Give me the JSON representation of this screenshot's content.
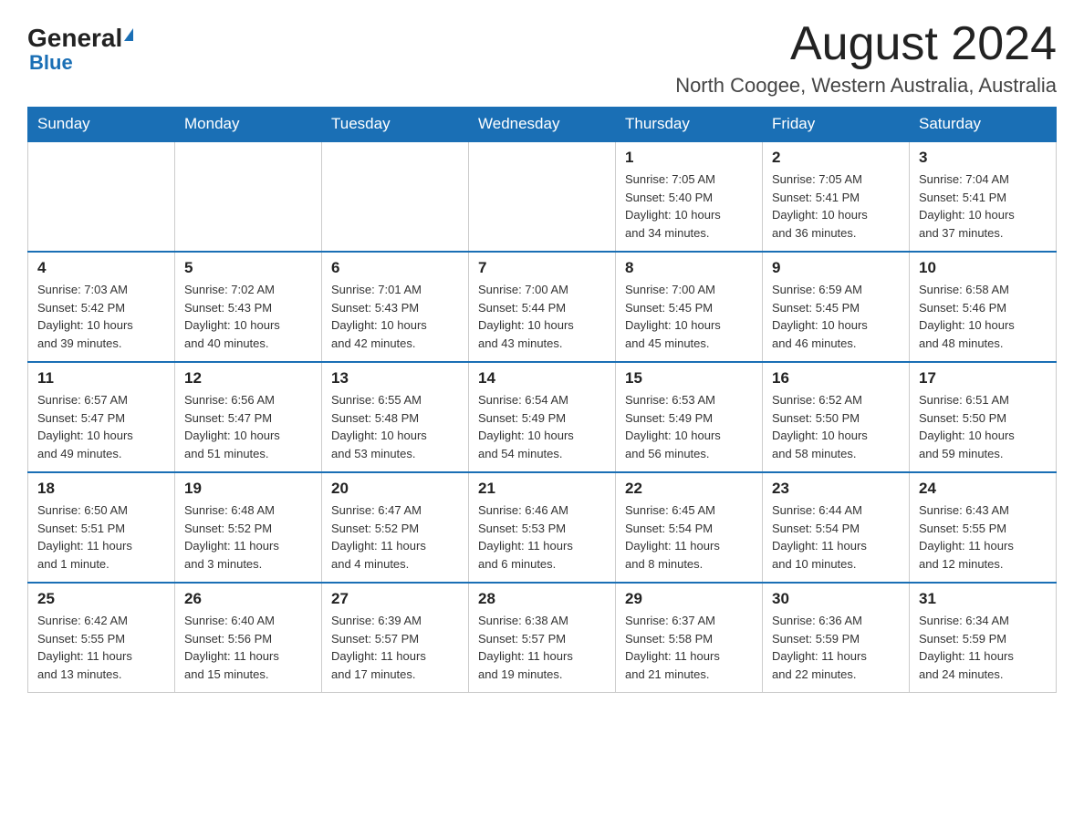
{
  "header": {
    "logo_general": "General",
    "logo_blue": "Blue",
    "month_title": "August 2024",
    "location": "North Coogee, Western Australia, Australia"
  },
  "days_of_week": [
    "Sunday",
    "Monday",
    "Tuesday",
    "Wednesday",
    "Thursday",
    "Friday",
    "Saturday"
  ],
  "weeks": [
    [
      {
        "day": "",
        "info": ""
      },
      {
        "day": "",
        "info": ""
      },
      {
        "day": "",
        "info": ""
      },
      {
        "day": "",
        "info": ""
      },
      {
        "day": "1",
        "info": "Sunrise: 7:05 AM\nSunset: 5:40 PM\nDaylight: 10 hours\nand 34 minutes."
      },
      {
        "day": "2",
        "info": "Sunrise: 7:05 AM\nSunset: 5:41 PM\nDaylight: 10 hours\nand 36 minutes."
      },
      {
        "day": "3",
        "info": "Sunrise: 7:04 AM\nSunset: 5:41 PM\nDaylight: 10 hours\nand 37 minutes."
      }
    ],
    [
      {
        "day": "4",
        "info": "Sunrise: 7:03 AM\nSunset: 5:42 PM\nDaylight: 10 hours\nand 39 minutes."
      },
      {
        "day": "5",
        "info": "Sunrise: 7:02 AM\nSunset: 5:43 PM\nDaylight: 10 hours\nand 40 minutes."
      },
      {
        "day": "6",
        "info": "Sunrise: 7:01 AM\nSunset: 5:43 PM\nDaylight: 10 hours\nand 42 minutes."
      },
      {
        "day": "7",
        "info": "Sunrise: 7:00 AM\nSunset: 5:44 PM\nDaylight: 10 hours\nand 43 minutes."
      },
      {
        "day": "8",
        "info": "Sunrise: 7:00 AM\nSunset: 5:45 PM\nDaylight: 10 hours\nand 45 minutes."
      },
      {
        "day": "9",
        "info": "Sunrise: 6:59 AM\nSunset: 5:45 PM\nDaylight: 10 hours\nand 46 minutes."
      },
      {
        "day": "10",
        "info": "Sunrise: 6:58 AM\nSunset: 5:46 PM\nDaylight: 10 hours\nand 48 minutes."
      }
    ],
    [
      {
        "day": "11",
        "info": "Sunrise: 6:57 AM\nSunset: 5:47 PM\nDaylight: 10 hours\nand 49 minutes."
      },
      {
        "day": "12",
        "info": "Sunrise: 6:56 AM\nSunset: 5:47 PM\nDaylight: 10 hours\nand 51 minutes."
      },
      {
        "day": "13",
        "info": "Sunrise: 6:55 AM\nSunset: 5:48 PM\nDaylight: 10 hours\nand 53 minutes."
      },
      {
        "day": "14",
        "info": "Sunrise: 6:54 AM\nSunset: 5:49 PM\nDaylight: 10 hours\nand 54 minutes."
      },
      {
        "day": "15",
        "info": "Sunrise: 6:53 AM\nSunset: 5:49 PM\nDaylight: 10 hours\nand 56 minutes."
      },
      {
        "day": "16",
        "info": "Sunrise: 6:52 AM\nSunset: 5:50 PM\nDaylight: 10 hours\nand 58 minutes."
      },
      {
        "day": "17",
        "info": "Sunrise: 6:51 AM\nSunset: 5:50 PM\nDaylight: 10 hours\nand 59 minutes."
      }
    ],
    [
      {
        "day": "18",
        "info": "Sunrise: 6:50 AM\nSunset: 5:51 PM\nDaylight: 11 hours\nand 1 minute."
      },
      {
        "day": "19",
        "info": "Sunrise: 6:48 AM\nSunset: 5:52 PM\nDaylight: 11 hours\nand 3 minutes."
      },
      {
        "day": "20",
        "info": "Sunrise: 6:47 AM\nSunset: 5:52 PM\nDaylight: 11 hours\nand 4 minutes."
      },
      {
        "day": "21",
        "info": "Sunrise: 6:46 AM\nSunset: 5:53 PM\nDaylight: 11 hours\nand 6 minutes."
      },
      {
        "day": "22",
        "info": "Sunrise: 6:45 AM\nSunset: 5:54 PM\nDaylight: 11 hours\nand 8 minutes."
      },
      {
        "day": "23",
        "info": "Sunrise: 6:44 AM\nSunset: 5:54 PM\nDaylight: 11 hours\nand 10 minutes."
      },
      {
        "day": "24",
        "info": "Sunrise: 6:43 AM\nSunset: 5:55 PM\nDaylight: 11 hours\nand 12 minutes."
      }
    ],
    [
      {
        "day": "25",
        "info": "Sunrise: 6:42 AM\nSunset: 5:55 PM\nDaylight: 11 hours\nand 13 minutes."
      },
      {
        "day": "26",
        "info": "Sunrise: 6:40 AM\nSunset: 5:56 PM\nDaylight: 11 hours\nand 15 minutes."
      },
      {
        "day": "27",
        "info": "Sunrise: 6:39 AM\nSunset: 5:57 PM\nDaylight: 11 hours\nand 17 minutes."
      },
      {
        "day": "28",
        "info": "Sunrise: 6:38 AM\nSunset: 5:57 PM\nDaylight: 11 hours\nand 19 minutes."
      },
      {
        "day": "29",
        "info": "Sunrise: 6:37 AM\nSunset: 5:58 PM\nDaylight: 11 hours\nand 21 minutes."
      },
      {
        "day": "30",
        "info": "Sunrise: 6:36 AM\nSunset: 5:59 PM\nDaylight: 11 hours\nand 22 minutes."
      },
      {
        "day": "31",
        "info": "Sunrise: 6:34 AM\nSunset: 5:59 PM\nDaylight: 11 hours\nand 24 minutes."
      }
    ]
  ]
}
